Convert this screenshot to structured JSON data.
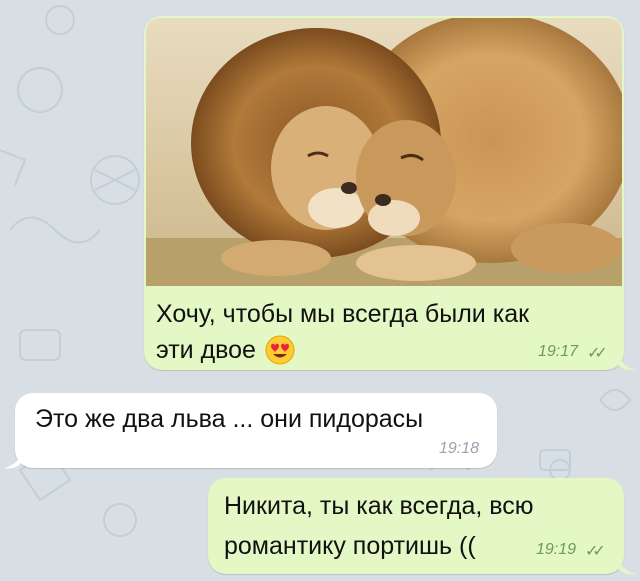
{
  "messages": [
    {
      "text_line1": "Хочу, чтобы мы всегда были как",
      "text_line2": "эти двое",
      "emoji": "heart-eyes-emoji",
      "time": "19:17",
      "read": "✓✓"
    },
    {
      "text": "Это же два льва ... они пидорасы",
      "time": "19:18"
    },
    {
      "text_line1": "Никита, ты как всегда, всю",
      "text_line2": "романтику портишь ((",
      "time": "19:19",
      "read": "✓✓"
    }
  ],
  "colors": {
    "background": "#d7dfe5",
    "outgoing_bubble": "#e3f8c5",
    "incoming_bubble": "#ffffff",
    "time_outgoing": "#6f9a5a"
  },
  "photo": {
    "subject": "two-lions-photo"
  }
}
